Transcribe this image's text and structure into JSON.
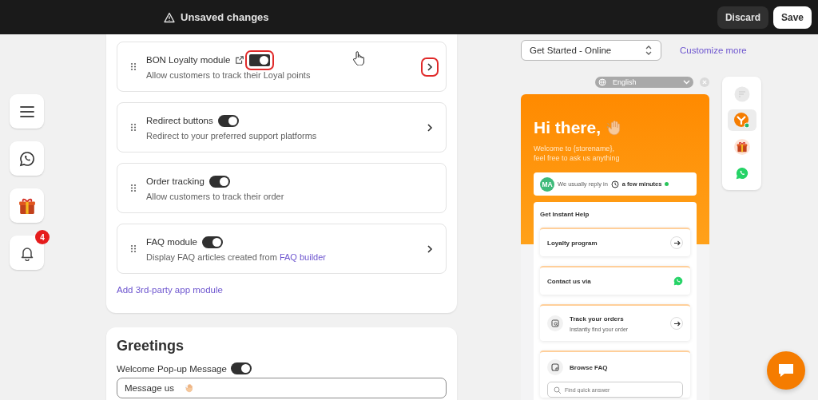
{
  "topbar": {
    "notice": "Unsaved changes",
    "buttons": [
      {
        "label": "Discard",
        "kind": "secondary"
      },
      {
        "label": "Save",
        "kind": "primary"
      }
    ]
  },
  "rail": [
    {
      "kind": "menu"
    },
    {
      "kind": "whatsapp"
    },
    {
      "kind": "gift"
    },
    {
      "kind": "bell",
      "badge": "4"
    }
  ],
  "modules": [
    {
      "title": "BON Loyalty module",
      "external_link": true,
      "on": true,
      "description": "Allow customers to track their Loyal points",
      "highlighted": true
    },
    {
      "title": "Redirect buttons",
      "external_link": false,
      "on": true,
      "description": "Redirect to your preferred support platforms",
      "highlighted": false
    },
    {
      "title": "Order tracking",
      "external_link": false,
      "on": true,
      "description": "Allow customers to track their order",
      "highlighted": false,
      "chevron": false
    },
    {
      "title": "FAQ module",
      "external_link": false,
      "on": true,
      "description": "Display FAQ articles created from ",
      "link": "FAQ builder",
      "highlighted": false
    }
  ],
  "add_module_link": "Add 3rd-party app module",
  "greetings": {
    "title": "Greetings",
    "popup_label": "Welcome Pop-up Message",
    "popup_on": true,
    "message": "Message us"
  },
  "preview": {
    "mode": "Get Started - Online",
    "customize": "Customize more",
    "language": "English",
    "greeting": "Hi there,",
    "welcome": [
      "Welcome to {storename},",
      "feel free to ask us anything"
    ],
    "avatar": "MA",
    "reply_prefix": "We usually reply in",
    "reply_time": "a few minutes",
    "online": true,
    "help_title": "Get Instant Help",
    "items": [
      {
        "kind": "arrow",
        "title": "Loyalty program"
      },
      {
        "kind": "whatsapp",
        "title": "Contact us via"
      },
      {
        "kind": "arrow",
        "title": "Track your orders",
        "subtitle": "Instantly find your order"
      },
      {
        "kind": "search",
        "title": "Browse FAQ",
        "placeholder": "Find quick answer"
      }
    ]
  },
  "launchers": [
    {
      "kind": "blank",
      "selected": false
    },
    {
      "kind": "logo",
      "selected": true
    },
    {
      "kind": "gift",
      "selected": false
    },
    {
      "kind": "whatsapp",
      "selected": false
    }
  ]
}
